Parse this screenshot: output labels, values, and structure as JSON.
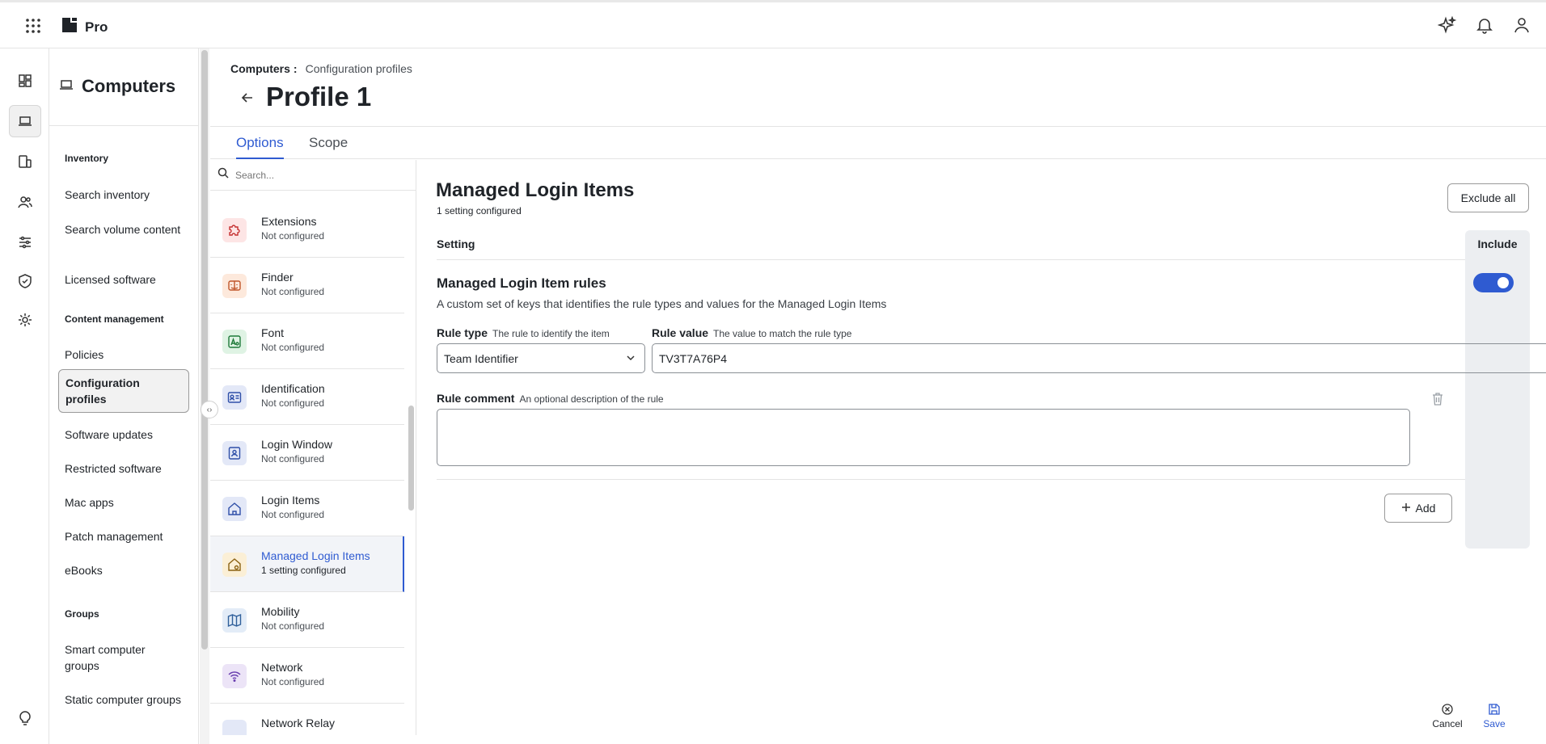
{
  "topbar": {
    "brand": "Pro"
  },
  "colors": {
    "accent": "#2f5bd1",
    "border": "#e4e4e4"
  },
  "nav": {
    "title": "Computers",
    "groups": [
      {
        "label": "Inventory",
        "items": [
          "Search inventory",
          "Search volume content",
          "Licensed software"
        ]
      },
      {
        "label": "Content management",
        "items": [
          "Policies",
          "Configuration profiles",
          "Software updates",
          "Restricted software",
          "Mac apps",
          "Patch management",
          "eBooks"
        ]
      },
      {
        "label": "Groups",
        "items": [
          "Smart computer groups",
          "Static computer groups"
        ]
      }
    ],
    "active_item": "Configuration profiles"
  },
  "header": {
    "breadcrumb_root": "Computers",
    "breadcrumb_sep": ":",
    "breadcrumb_current": "Configuration profiles",
    "title": "Profile 1",
    "tabs": [
      "Options",
      "Scope"
    ],
    "active_tab": "Options"
  },
  "list": {
    "search_placeholder": "Search...",
    "items": [
      {
        "name": "Extensions",
        "status": "Not configured",
        "icon": "puzzle-icon"
      },
      {
        "name": "Finder",
        "status": "Not configured",
        "icon": "finder-icon"
      },
      {
        "name": "Font",
        "status": "Not configured",
        "icon": "font-icon"
      },
      {
        "name": "Identification",
        "status": "Not configured",
        "icon": "id-card-icon"
      },
      {
        "name": "Login Window",
        "status": "Not configured",
        "icon": "login-window-icon"
      },
      {
        "name": "Login Items",
        "status": "Not configured",
        "icon": "home-icon"
      },
      {
        "name": "Managed Login Items",
        "status": "1 setting configured",
        "icon": "home-gear-icon"
      },
      {
        "name": "Mobility",
        "status": "Not configured",
        "icon": "map-icon"
      },
      {
        "name": "Network",
        "status": "Not configured",
        "icon": "wifi-icon"
      },
      {
        "name": "Network Relay",
        "status": "",
        "icon": "relay-icon"
      }
    ]
  },
  "content": {
    "title": "Managed Login Items",
    "subtitle": "1 setting configured",
    "exclude_all": "Exclude all",
    "setting_header": "Setting",
    "include_header": "Include",
    "include_enabled": true,
    "rules_title": "Managed Login Item rules",
    "rules_desc": "A custom set of keys that identifies the rule types and values for the Managed Login Items",
    "rule_type_label": "Rule type",
    "rule_type_hint": "The rule to identify the item",
    "rule_type_value": "Team Identifier",
    "rule_value_label": "Rule value",
    "rule_value_hint": "The value to match the rule type",
    "rule_value_value": "TV3T7A76P4",
    "rule_comment_label": "Rule comment",
    "rule_comment_hint": "An optional description of the rule",
    "rule_comment_value": "",
    "add_label": "Add"
  },
  "footer": {
    "cancel": "Cancel",
    "save": "Save"
  }
}
